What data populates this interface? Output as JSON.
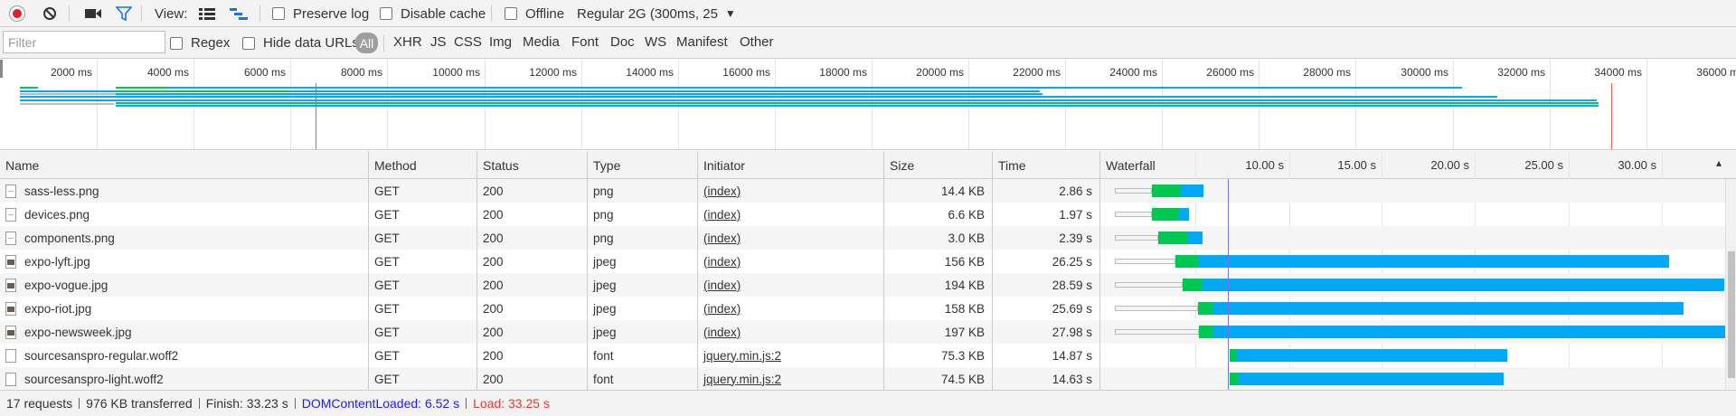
{
  "toolbar": {
    "view_label": "View:",
    "preserve_log": "Preserve log",
    "disable_cache": "Disable cache",
    "offline": "Offline",
    "throttling": "Regular 2G (300ms, 25",
    "throttling_arrow": "▼"
  },
  "filterbar": {
    "placeholder": "Filter",
    "regex": "Regex",
    "hide_data_urls": "Hide data URLs",
    "types": [
      "All",
      "XHR",
      "JS",
      "CSS",
      "Img",
      "Media",
      "Font",
      "Doc",
      "WS",
      "Manifest",
      "Other"
    ]
  },
  "overview": {
    "ticks": [
      "2000 ms",
      "4000 ms",
      "6000 ms",
      "8000 ms",
      "10000 ms",
      "12000 ms",
      "14000 ms",
      "16000 ms",
      "18000 ms",
      "20000 ms",
      "22000 ms",
      "24000 ms",
      "26000 ms",
      "28000 ms",
      "30000 ms",
      "32000 ms",
      "34000 ms",
      "36000 m"
    ]
  },
  "columns": {
    "name": "Name",
    "method": "Method",
    "status": "Status",
    "type": "Type",
    "initiator": "Initiator",
    "size": "Size",
    "time": "Time",
    "waterfall": "Waterfall",
    "waterfall_ticks": [
      "10.00 s",
      "15.00 s",
      "20.00 s",
      "25.00 s",
      "30.00 s"
    ]
  },
  "rows": [
    {
      "name": "sass-less.png",
      "icon": "png-file-icon",
      "method": "GET",
      "status": "200",
      "type": "png",
      "initiator": "(index)",
      "size": "14.4 KB",
      "time": "2.86 s"
    },
    {
      "name": "devices.png",
      "icon": "png-file-icon",
      "method": "GET",
      "status": "200",
      "type": "png",
      "initiator": "(index)",
      "size": "6.6 KB",
      "time": "1.97 s"
    },
    {
      "name": "components.png",
      "icon": "png-file-icon",
      "method": "GET",
      "status": "200",
      "type": "png",
      "initiator": "(index)",
      "size": "3.0 KB",
      "time": "2.39 s"
    },
    {
      "name": "expo-lyft.jpg",
      "icon": "image-thumbnail-icon",
      "method": "GET",
      "status": "200",
      "type": "jpeg",
      "initiator": "(index)",
      "size": "156 KB",
      "time": "26.25 s"
    },
    {
      "name": "expo-vogue.jpg",
      "icon": "image-thumbnail-icon",
      "method": "GET",
      "status": "200",
      "type": "jpeg",
      "initiator": "(index)",
      "size": "194 KB",
      "time": "28.59 s"
    },
    {
      "name": "expo-riot.jpg",
      "icon": "image-thumbnail-icon",
      "method": "GET",
      "status": "200",
      "type": "jpeg",
      "initiator": "(index)",
      "size": "158 KB",
      "time": "25.69 s"
    },
    {
      "name": "expo-newsweek.jpg",
      "icon": "image-thumbnail-icon",
      "method": "GET",
      "status": "200",
      "type": "jpeg",
      "initiator": "(index)",
      "size": "197 KB",
      "time": "27.98 s"
    },
    {
      "name": "sourcesanspro-regular.woff2",
      "icon": "font-file-icon",
      "method": "GET",
      "status": "200",
      "type": "font",
      "initiator": "jquery.min.js:2",
      "size": "75.3 KB",
      "time": "14.87 s"
    },
    {
      "name": "sourcesanspro-light.woff2",
      "icon": "font-file-icon",
      "method": "GET",
      "status": "200",
      "type": "font",
      "initiator": "jquery.min.js:2",
      "size": "74.5 KB",
      "time": "14.63 s"
    }
  ],
  "status": {
    "requests": "17 requests",
    "transferred": "976 KB transferred",
    "finish": "Finish: 33.23 s",
    "dom_content_loaded": "DOMContentLoaded: 6.52 s",
    "load": "Load: 33.25 s"
  },
  "colors": {
    "record": "#e51c23",
    "waiting": "#00c853",
    "downloading": "#03a9f4",
    "dcl_line": "#7575ff",
    "load_line": "#ff5252",
    "dcl_text": "#1a1aff",
    "load_text": "#e53935"
  }
}
